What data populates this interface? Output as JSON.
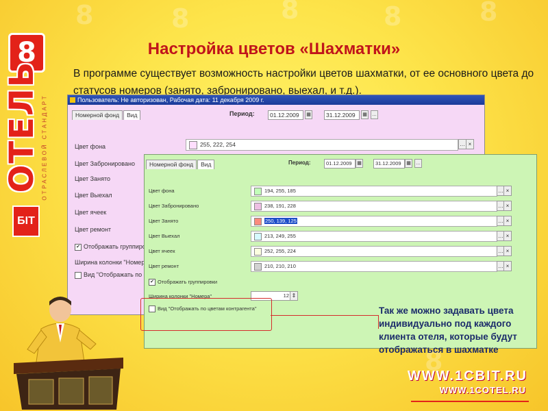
{
  "brand": {
    "digit": "8",
    "name": "ОТЕЛЬ",
    "tagline": "ОТРАСЛЕВОЙ СТАНДАРТ",
    "logo": "БIТ"
  },
  "slide": {
    "title": "Настройка цветов «Шахматки»",
    "intro": "В программе существует возможность настройки цветов шахматки, от ее основного цвета до статусов номеров (занято, забронировано, выехал,  и т.д.).",
    "callout": "Так же можно задавать цвета индивидуально под каждого клиента отеля, которые будут отображаться в шахматке"
  },
  "back_window": {
    "titlebar": "Пользователь: Не авторизован, Рабочая дата: 11 декабря 2009 г.",
    "tabs": [
      "Номерной фонд",
      "Вид"
    ],
    "period_label": "Период:",
    "date_from": "01.12.2009",
    "date_to": "31.12.2009",
    "field_value": "255, 222, 254",
    "swatch": "#ffdefe",
    "rows": [
      "Цвет фона",
      "Цвет Забронировано",
      "Цвет Занято",
      "Цвет Выехал",
      "Цвет ячеек",
      "Цвет ремонт"
    ],
    "show_grouping": "Отображать группировки",
    "col_width": "Ширина колонки \"Номера\"",
    "contractor_view": "Вид \"Отображать по цветам"
  },
  "front_window": {
    "tabs": [
      "Номерной фонд",
      "Вид"
    ],
    "period_label": "Период:",
    "date_from": "01.12.2009",
    "date_to": "31.12.2009",
    "rows": [
      {
        "label": "Цвет фона",
        "value": "194, 255, 185",
        "color": "#c2ffb9"
      },
      {
        "label": "Цвет Забронировано",
        "value": "238, 191, 228",
        "color": "#eebfe4"
      },
      {
        "label": "Цвет Занято",
        "value": "250, 139, 125",
        "color": "#fa8b7d"
      },
      {
        "label": "Цвет Выехал",
        "value": "213, 249, 255",
        "color": "#d5f9ff"
      },
      {
        "label": "Цвет ячеек",
        "value": "252, 255, 224",
        "color": "#fcffe0"
      },
      {
        "label": "Цвет ремонт",
        "value": "210, 210, 210",
        "color": "#d2d2d2"
      }
    ],
    "show_grouping": "Отображать группировки",
    "col_width_label": "Ширина колонки \"Номера\"",
    "col_width_value": "12",
    "contractor_view": "Вид \"Отображать по цветам контрагента\""
  },
  "footer": {
    "url1": "WWW.1CBIT.RU",
    "url2": "WWW.1COTEL.RU"
  }
}
